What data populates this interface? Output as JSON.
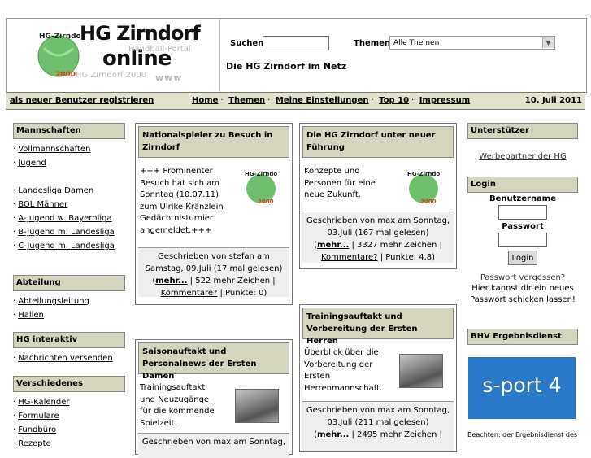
{
  "header": {
    "logo_title1": "HG Zirndorf",
    "logo_title2": "online",
    "logo_portal": "Handball-Portal",
    "logo_hgz": "HG Zirndorf 2000",
    "logo_www": "www",
    "search_label": "Suchen",
    "search_value": "",
    "themen_label": "Themen",
    "themen_selected": "Alle Themen",
    "tagline": "Die HG Zirndorf im Netz"
  },
  "navbar": {
    "register": "als neuer Benutzer registrieren",
    "items": [
      "Home",
      "Themen",
      "Meine Einstellungen",
      "Top 10",
      "Impressum"
    ],
    "date": "10. Juli 2011"
  },
  "left": {
    "mannschaften": {
      "title": "Mannschaften",
      "items": [
        "Vollmannschaften",
        "Jugend",
        "",
        "Landesliga Damen",
        "BOL Männer",
        "A-Jugend w. Bayernliga",
        "B-Jugend m. Landesliga",
        "C-Jugend m. Landesliga"
      ]
    },
    "abteilung": {
      "title": "Abteilung",
      "items": [
        "Abteilungsleitung",
        "Hallen"
      ]
    },
    "interaktiv": {
      "title": "HG interaktiv",
      "items": [
        "Nachrichten versenden"
      ]
    },
    "verschiedenes": {
      "title": "Verschiedenes",
      "items": [
        "HG-Kalender",
        "Formulare",
        "Fundbüro",
        "Rezepte"
      ]
    }
  },
  "articles": [
    {
      "title": "Nationalspieler zu Besuch in Zirndorf",
      "text": "+++ Prominenter Besuch hat sich am Sonntag (10.07.11) zum Ulrike Kränzlein Gedächtnisturnier angemeldet.+++",
      "footer_line1": "Geschrieben von stefan am Samstag, 09.Juli (17 mal gelesen)",
      "more": "mehr...",
      "chars": " | 522 mehr Zeichen |",
      "comments": "Kommentare?",
      "points": " | Punkte: 0)"
    },
    {
      "title": "Die HG Zirndorf unter neuer Führung",
      "text": "Konzepte und Personen für eine neue Zukunft.",
      "footer_line1": "Geschrieben von max am Sonntag, 03.Juli (167 mal gelesen)",
      "more": "mehr...",
      "chars": " | 3327 mehr Zeichen |",
      "comments": "Kommentare?",
      "points": " | Punkte: 4,8)"
    },
    {
      "title": "Saisonauftakt und Personalnews der Ersten Damen",
      "text": "Trainingsauftakt und Neuzugänge für die kommende Spielzeit.",
      "footer_line1": "Geschrieben von max am Sonntag,"
    },
    {
      "title": "Trainingsauftakt und Vorbereitung der Ersten Herren",
      "text": "Überblick über die Vorbereitung der Ersten Herrenmannschaft.",
      "footer_line1": "Geschrieben von max am Sonntag, 03.Juli (211 mal gelesen)",
      "more": "mehr...",
      "chars": " | 2495 mehr Zeichen |"
    }
  ],
  "right": {
    "unterstuetzer_title": "Unterstützer",
    "werbepartner": "Werbepartner der HG",
    "login_title": "Login",
    "benutzername": "Benutzername",
    "passwort": "Passwort",
    "login_button": "Login",
    "forgot": "Passwort vergessen?",
    "forgot_text": "Hier kannst dir ein neues Passwort schicken lassen!",
    "bhv_title": "BHV Ergebnisdienst",
    "sport4": "s-port 4",
    "beachten": "Beachten: der Ergebnisdienst des"
  },
  "colors": {
    "box_header": "#d4d4bf",
    "navbar": "#e2e2cf",
    "sport4": "#2a78c8"
  }
}
